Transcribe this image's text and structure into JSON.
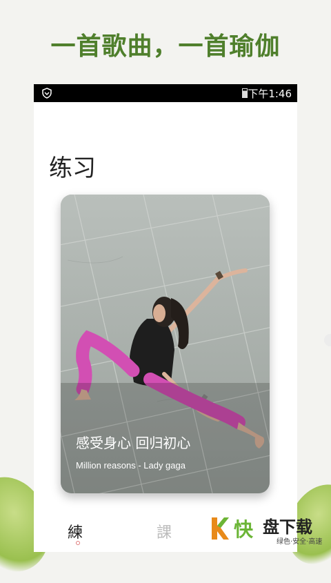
{
  "promo": {
    "title": "一首歌曲，一首瑜伽"
  },
  "status_bar": {
    "time": "下午1:46",
    "shield_icon": "shield-icon",
    "battery_icon": "battery-icon"
  },
  "page": {
    "title": "练习"
  },
  "card": {
    "headline": "感受身心 回归初心",
    "song": "Million reasons - Lady gaga",
    "image": "yoga-pose-photo"
  },
  "tabs": [
    {
      "label": "練",
      "active": true
    },
    {
      "label": "課",
      "active": false
    }
  ],
  "watermark": {
    "main": "快",
    "brand": "盘下载",
    "tagline": "绿色·安全·高速"
  },
  "colors": {
    "promo_green": "#4f7f2c",
    "watermark_green": "#6bb536",
    "legging_pink": "#d24fb3"
  }
}
